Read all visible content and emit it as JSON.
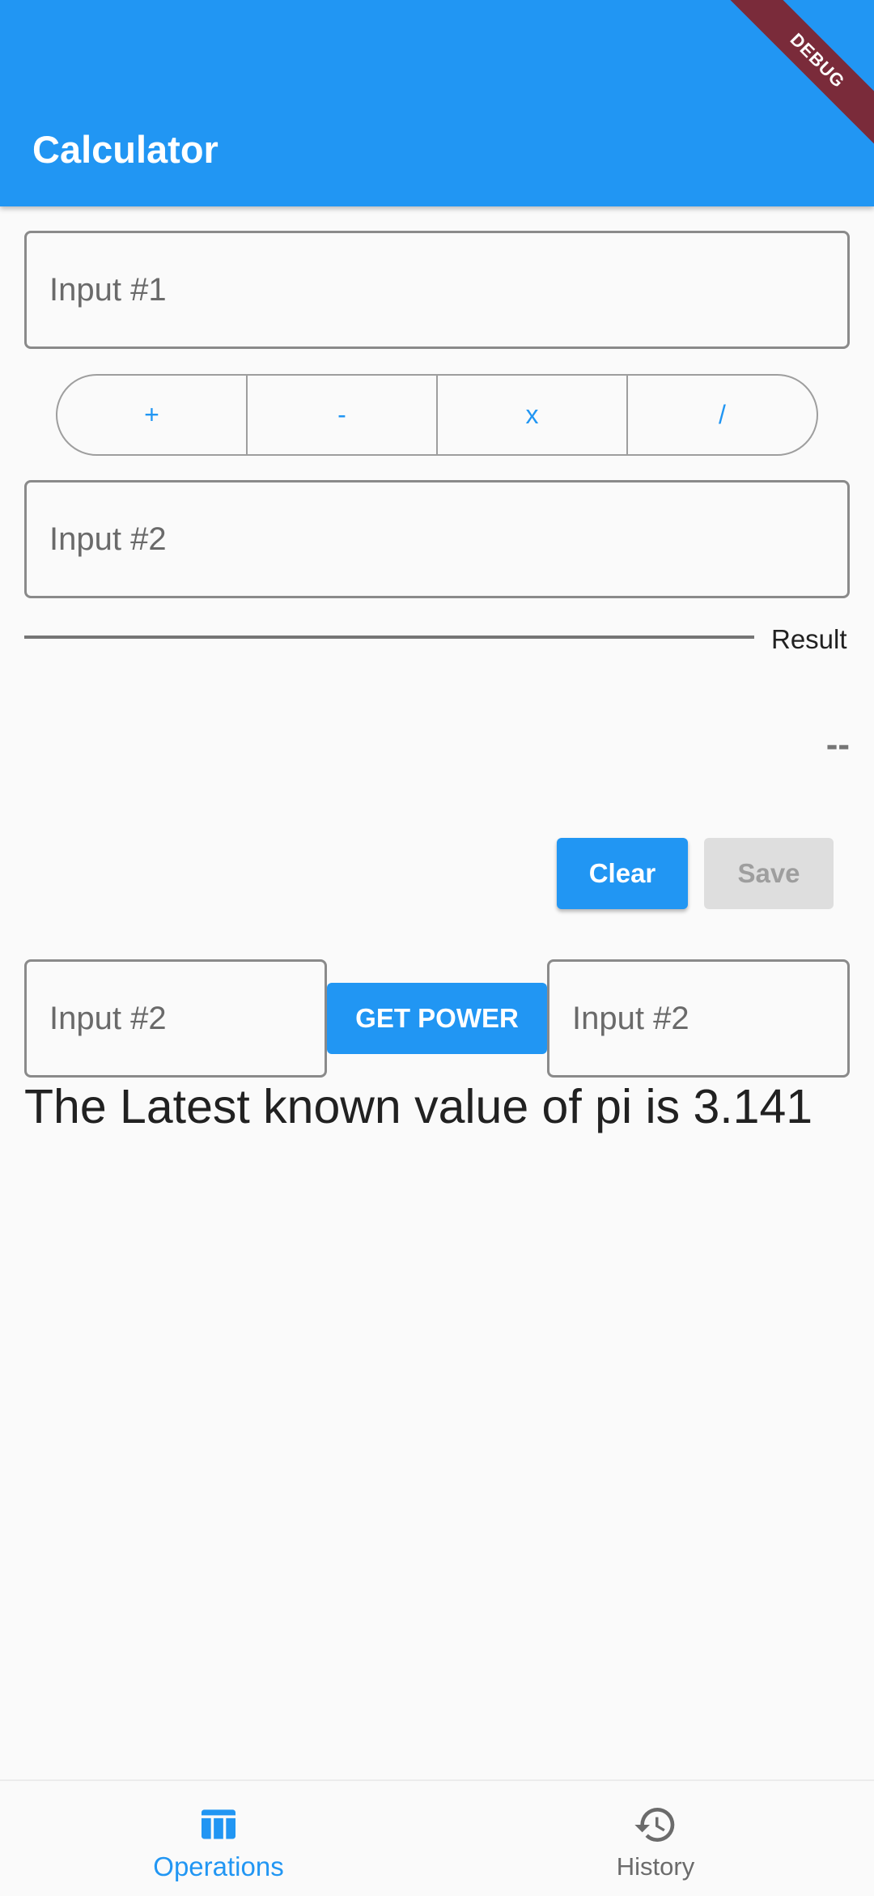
{
  "app_bar": {
    "title": "Calculator",
    "debug_banner": "DEBUG",
    "color": "#2196f3"
  },
  "inputs": {
    "input1_placeholder": "Input #1",
    "input2_placeholder": "Input #2"
  },
  "operators": {
    "items": [
      "+",
      "-",
      "x",
      "/"
    ]
  },
  "result": {
    "label": "Result",
    "value": "--"
  },
  "actions": {
    "clear_label": "Clear",
    "save_label": "Save"
  },
  "power": {
    "base_placeholder": "Input #2",
    "button_label": "GET POWER",
    "exponent_placeholder": "Input #2"
  },
  "pi_message": "The Latest known value of pi is 3.141",
  "bottom_nav": {
    "items": [
      {
        "label": "Operations",
        "icon": "table-icon",
        "active": true
      },
      {
        "label": "History",
        "icon": "history-icon",
        "active": false
      }
    ]
  }
}
